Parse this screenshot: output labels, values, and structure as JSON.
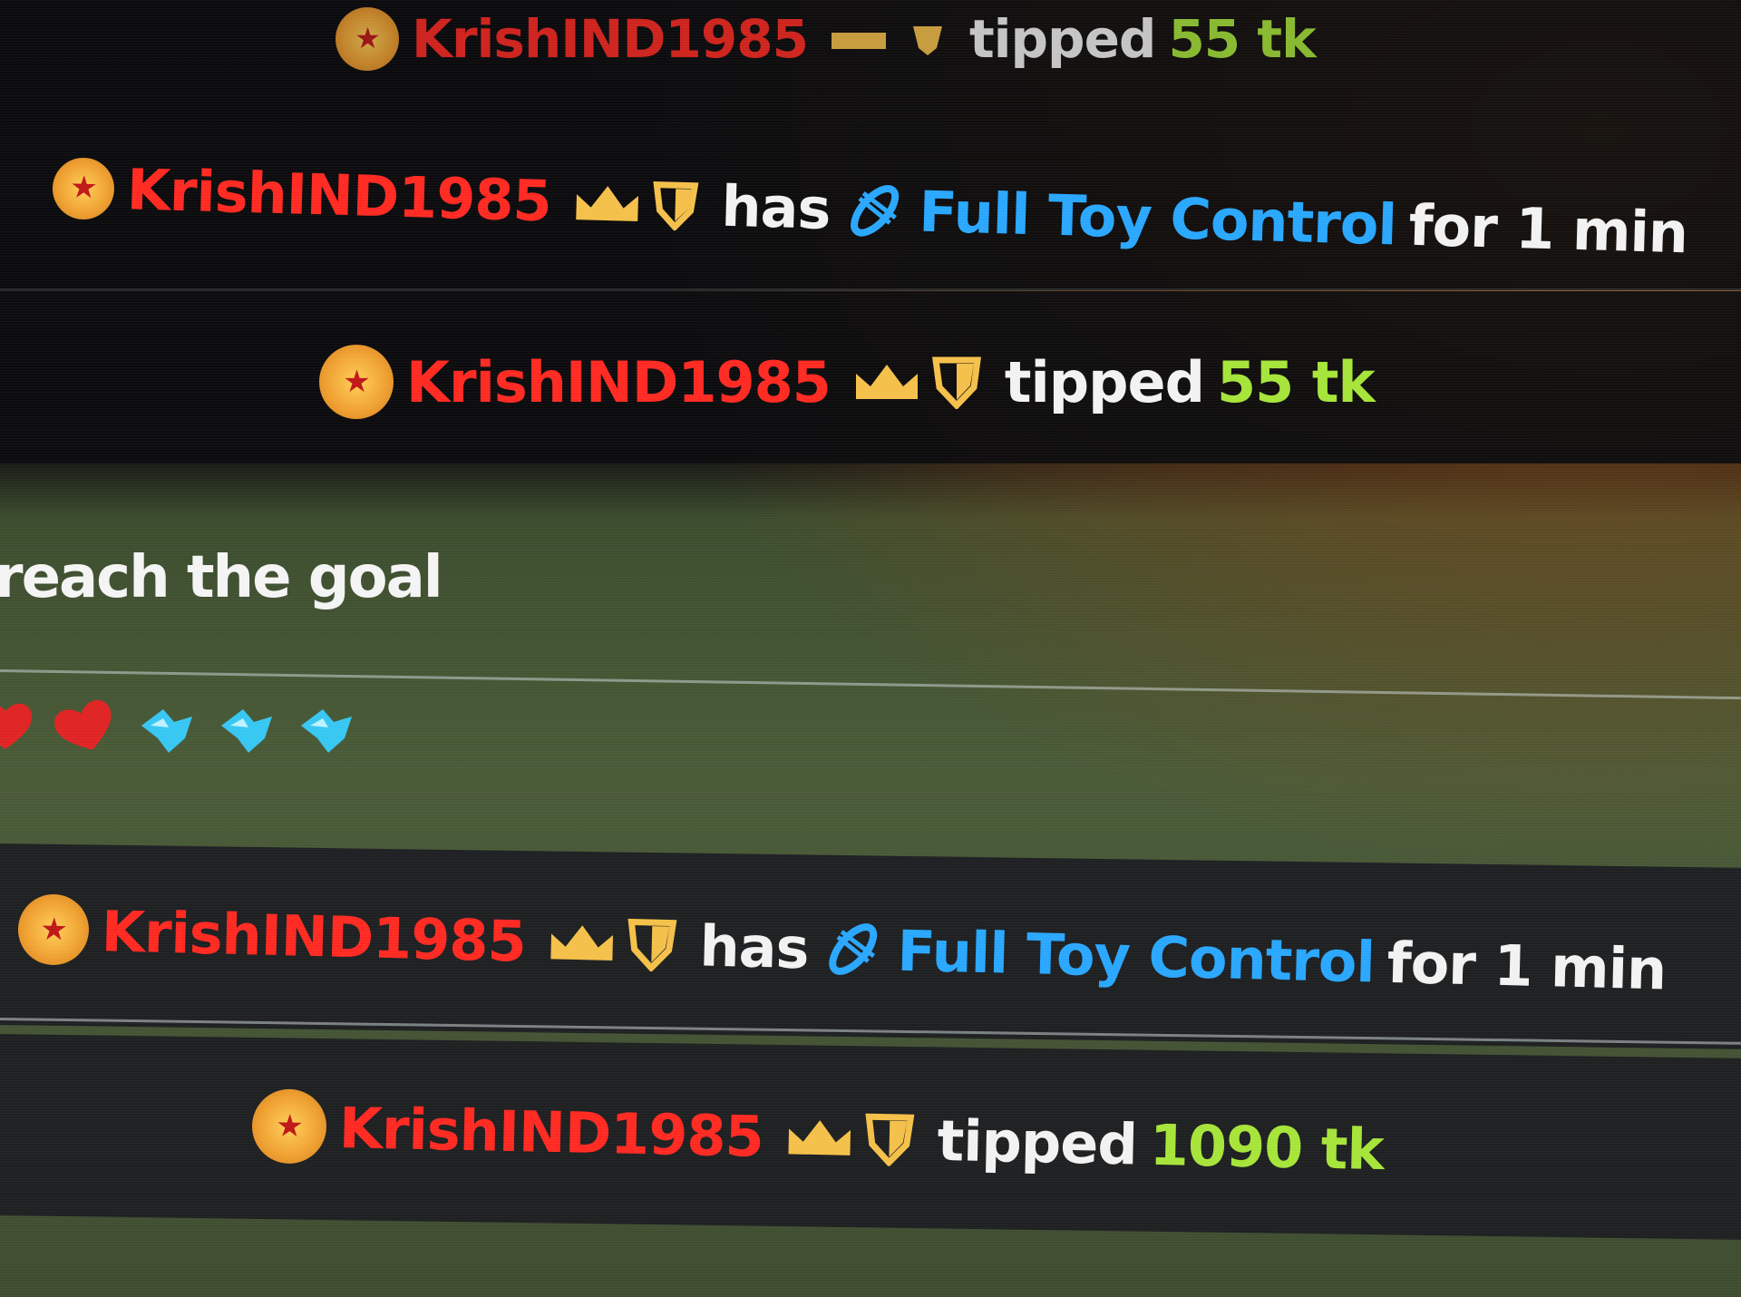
{
  "chat": {
    "top_partial": {
      "user": "KrishIND1985",
      "verb": "tipped",
      "amount": "55 tk"
    },
    "messages": [
      {
        "user": "KrishIND1985",
        "prefix": "has",
        "reward": "Full Toy Control",
        "suffix": "for 1 min"
      },
      {
        "user": "KrishIND1985",
        "verb": "tipped",
        "amount": "55 tk"
      },
      {
        "user": "KrishIND1985",
        "prefix": "has",
        "reward": "Full Toy Control",
        "suffix": "for 1 min"
      },
      {
        "user": "KrishIND1985",
        "verb": "tipped",
        "amount": "1090 tk"
      }
    ],
    "goal_text": "reach the goal",
    "emojis": [
      "red-heart-icon",
      "red-heart-icon",
      "blue-sparkle-icon",
      "blue-sparkle-icon",
      "blue-sparkle-icon"
    ]
  },
  "colors": {
    "username": "#ff2a22",
    "reward": "#2aa7ff",
    "amount": "#a6e43a",
    "text": "#f2f2f2",
    "badge": "#f4c04a"
  }
}
